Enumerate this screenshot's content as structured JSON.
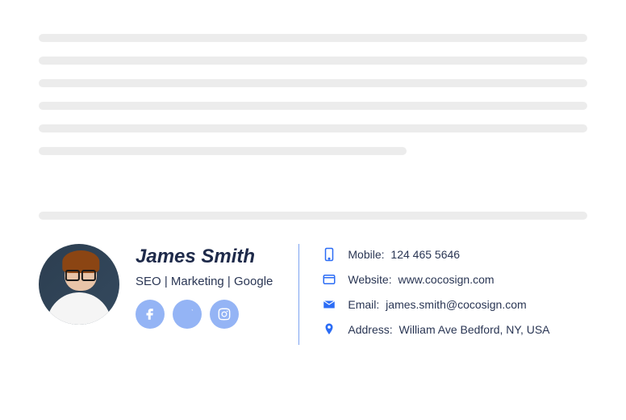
{
  "signature": {
    "name": "James Smith",
    "title": "SEO | Marketing | Google",
    "social": {
      "facebook": "facebook",
      "twitter": "twitter",
      "instagram": "instagram"
    },
    "contact": {
      "mobile": {
        "label": "Mobile:",
        "value": "124 465 5646"
      },
      "website": {
        "label": "Website:",
        "value": "www.cocosign.com"
      },
      "email": {
        "label": "Email:",
        "value": "james.smith@cocosign.com"
      },
      "address": {
        "label": "Address:",
        "value": "William Ave Bedford, NY, USA"
      }
    }
  }
}
